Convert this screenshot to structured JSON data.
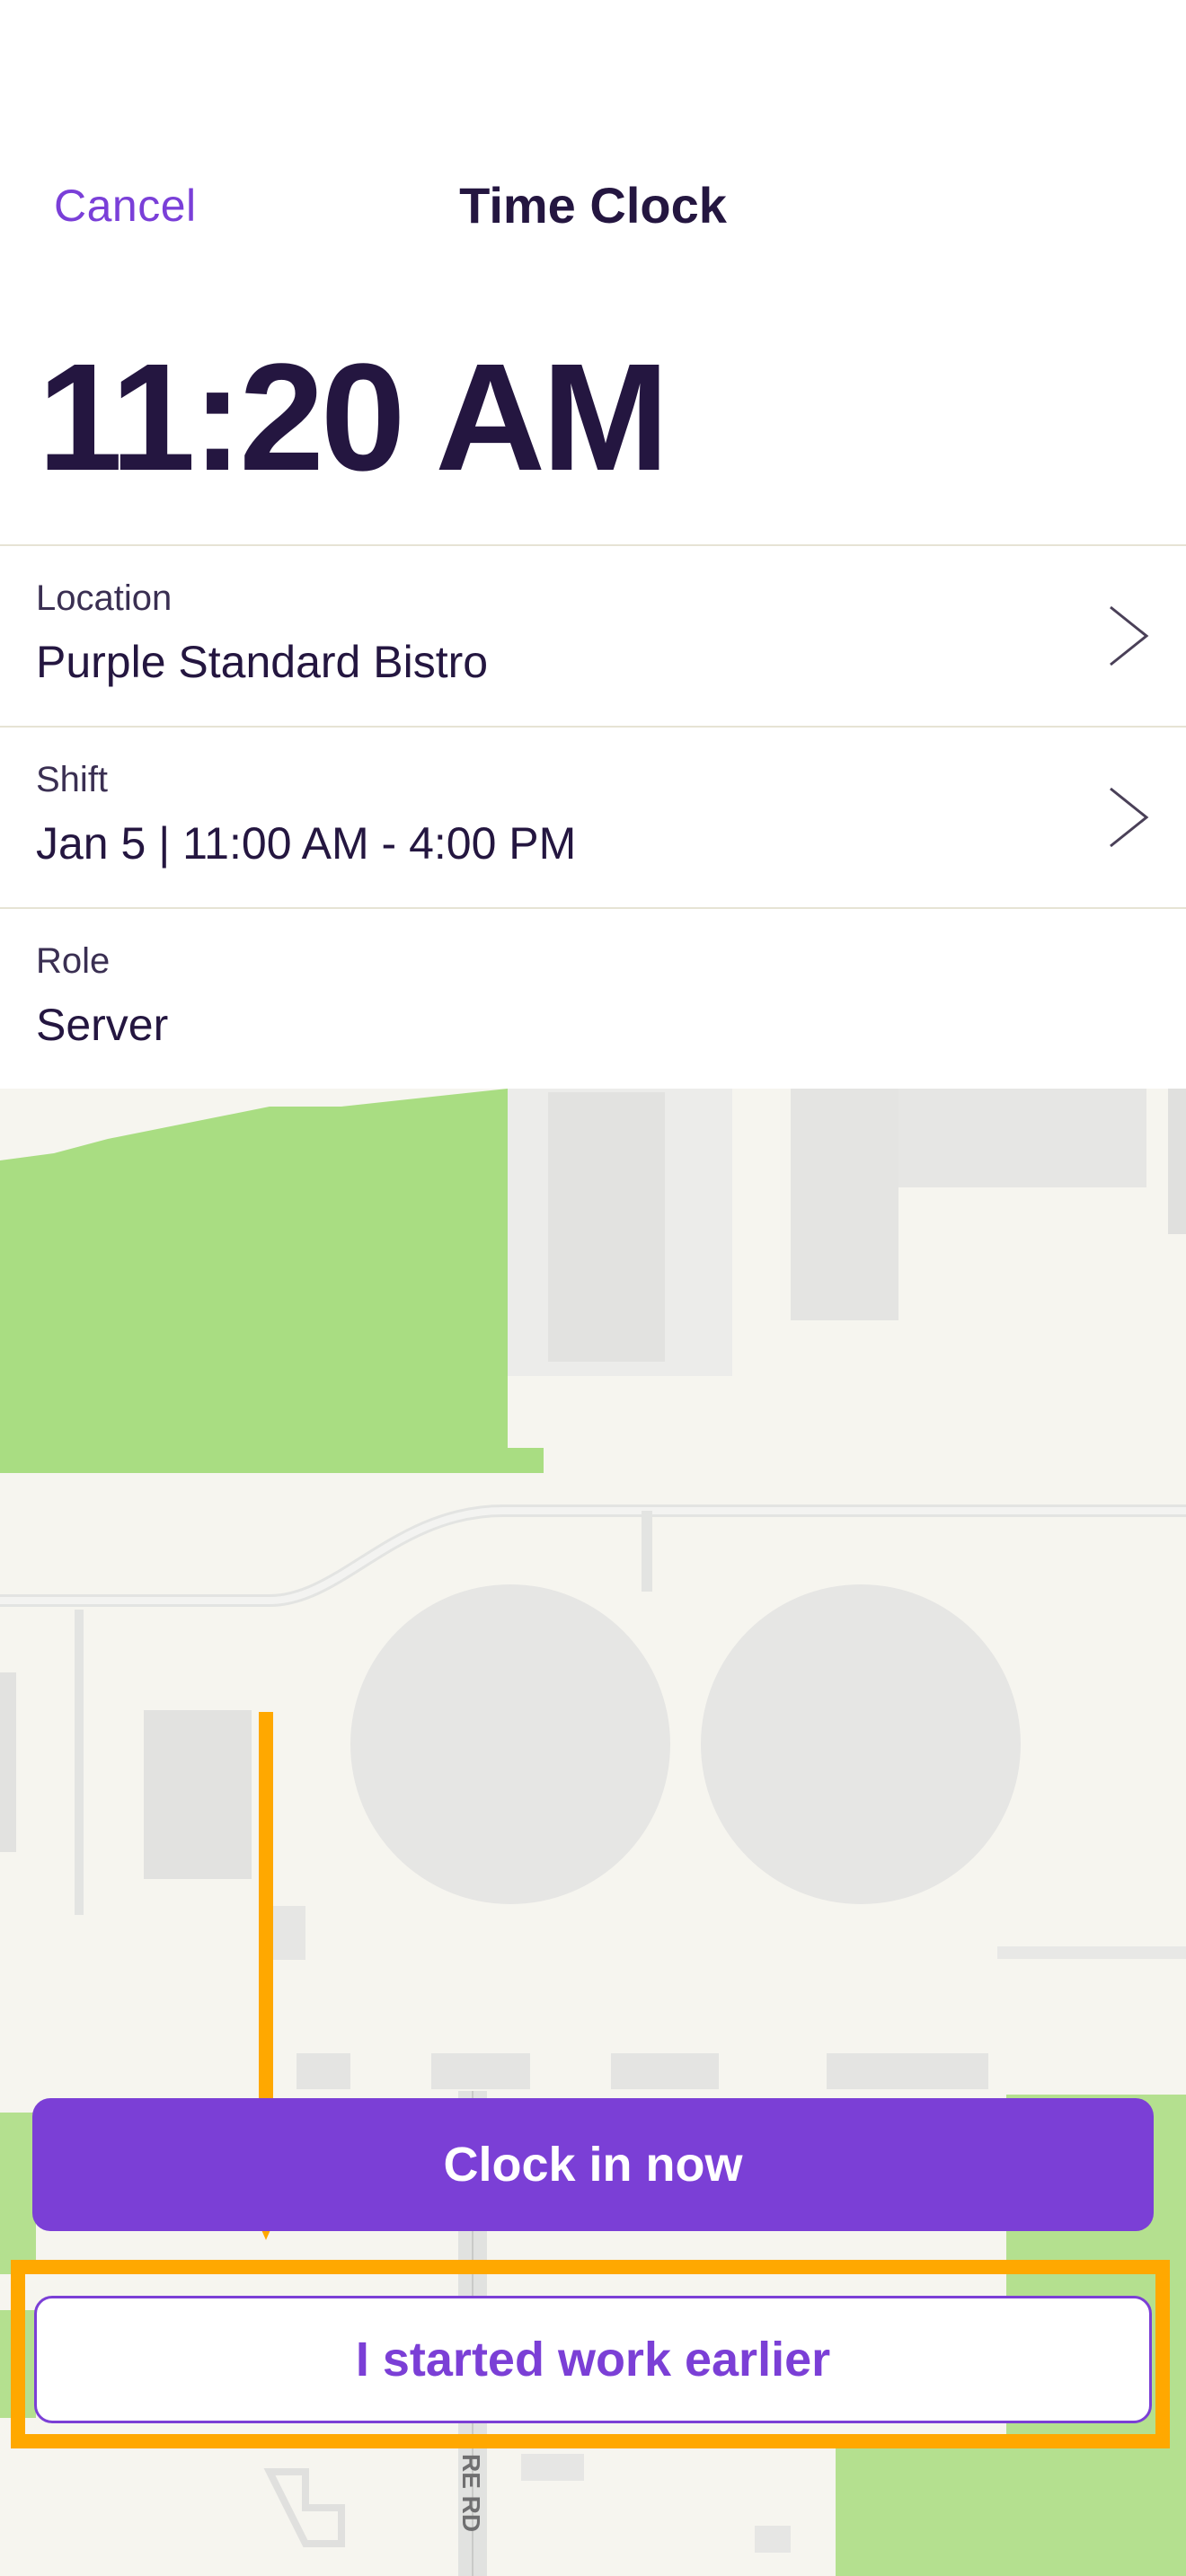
{
  "header": {
    "cancel_label": "Cancel",
    "title": "Time Clock"
  },
  "current_time": "11:20 AM",
  "details": {
    "location": {
      "label": "Location",
      "value": "Purple Standard Bistro"
    },
    "shift": {
      "label": "Shift",
      "value": "Jan 5 | 11:00 AM - 4:00 PM"
    },
    "role": {
      "label": "Role",
      "value": "Server"
    }
  },
  "map": {
    "road_label": "RE RD"
  },
  "actions": {
    "clock_in_label": "Clock in now",
    "started_earlier_label": "I started work earlier"
  },
  "colors": {
    "accent": "#7b3fd6",
    "text_dark": "#241640",
    "annotation": "#ffa800",
    "map_green": "#a9dd82",
    "map_bg": "#f6f5ef"
  },
  "icons": [
    "chevron-right-icon",
    "chevron-right-icon"
  ]
}
